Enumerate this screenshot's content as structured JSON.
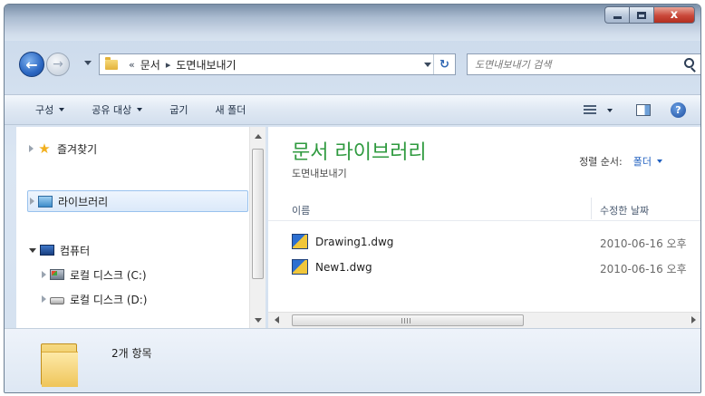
{
  "window": {
    "min_label": "",
    "max_label": "",
    "close_label": "x"
  },
  "address": {
    "crumb_sep": "«",
    "crumb_arrow": "▸",
    "crumbs": [
      "문서",
      "도면내보내기"
    ],
    "refresh_glyph": "↻"
  },
  "search": {
    "placeholder": "도면내보내기 검색"
  },
  "toolbar": {
    "organize": "구성",
    "share": "공유 대상",
    "burn": "굽기",
    "new_folder": "새 폴더"
  },
  "nav": {
    "favorites": "즐겨찾기",
    "libraries": "라이브러리",
    "computer": "컴퓨터",
    "drive_c": "로컬 디스크 (C:)",
    "drive_d": "로컬 디스크 (D:)"
  },
  "content": {
    "library_title": "문서 라이브러리",
    "library_subtitle": "도면내보내기",
    "arrange_label": "정렬 순서:",
    "arrange_value": "폴더",
    "col_name": "이름",
    "col_date": "수정한 날짜",
    "files": [
      {
        "name": "Drawing1.dwg",
        "date": "2010-06-16 오후"
      },
      {
        "name": "New1.dwg",
        "date": "2010-06-16 오후"
      }
    ]
  },
  "details": {
    "item_count": "2개 항목"
  },
  "icons": {
    "back": "back-arrow-icon",
    "forward": "forward-arrow-icon",
    "folder": "folder-icon",
    "star": "star-icon",
    "library": "library-icon",
    "computer": "computer-icon",
    "drive": "drive-icon",
    "dwg": "dwg-file-icon"
  }
}
